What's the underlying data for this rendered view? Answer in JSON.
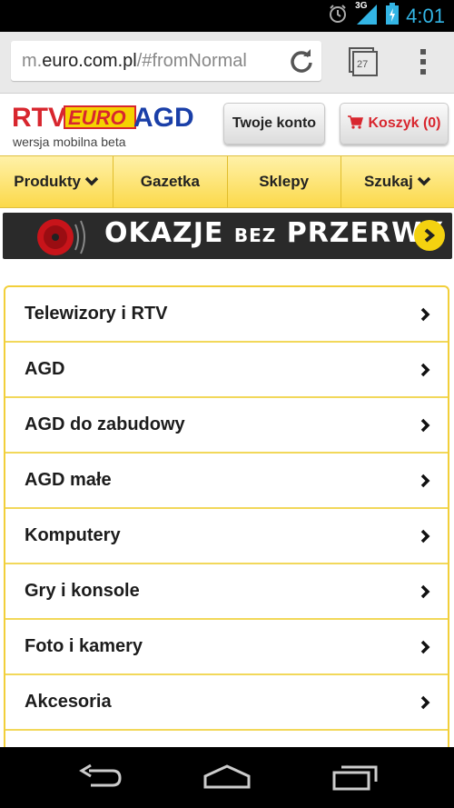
{
  "status_bar": {
    "network": "3G",
    "time": "4:01"
  },
  "browser": {
    "url_prefix": "m.",
    "url_domain": "euro.com.pl",
    "url_suffix": "/#fromNormal",
    "tab_count": "27"
  },
  "header": {
    "logo_rtv": "RTV",
    "logo_euro": "EURO",
    "logo_agd": "AGD",
    "subtitle": "wersja mobilna beta",
    "account_button": "Twoje konto",
    "cart_button": "Koszyk (0)"
  },
  "nav": [
    {
      "label": "Produkty",
      "has_dropdown": true
    },
    {
      "label": "Gazetka",
      "has_dropdown": false
    },
    {
      "label": "Sklepy",
      "has_dropdown": false
    },
    {
      "label": "Szukaj",
      "has_dropdown": true
    }
  ],
  "banner": {
    "text_main_1": "OKAZJE",
    "text_small": "BEZ",
    "text_main_2": "PRZERWY"
  },
  "categories": [
    "Telewizory i RTV",
    "AGD",
    "AGD do zabudowy",
    "AGD małe",
    "Komputery",
    "Gry i konsole",
    "Foto i kamery",
    "Akcesoria"
  ],
  "colors": {
    "accent_yellow": "#fbd94a",
    "brand_red": "#d8262e",
    "brand_blue": "#1a3fa8",
    "status_blue": "#33b5e5"
  }
}
